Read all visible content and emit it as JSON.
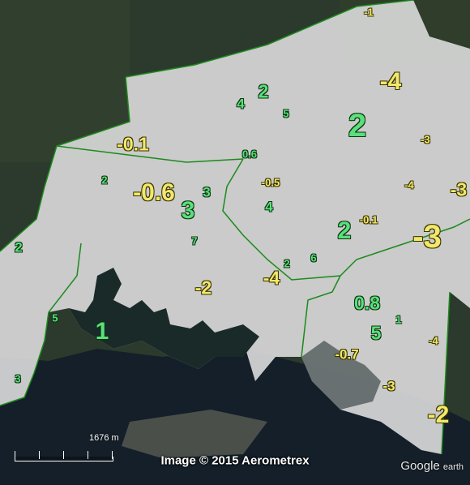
{
  "map": {
    "colors": {
      "land": "#2b3a2c",
      "water": "#141f29",
      "region": "#dcdcdc",
      "boundary": "#1c8a1c",
      "positive": "#59e07a",
      "negative": "#f2e86a"
    },
    "labels": [
      {
        "text": "-1",
        "kind": "neg"
      },
      {
        "text": "-4",
        "kind": "neg"
      },
      {
        "text": "2",
        "kind": "pos"
      },
      {
        "text": "4",
        "kind": "pos"
      },
      {
        "text": "5",
        "kind": "pos"
      },
      {
        "text": "2",
        "kind": "pos"
      },
      {
        "text": "-3",
        "kind": "neg"
      },
      {
        "text": "-0.1",
        "kind": "neg"
      },
      {
        "text": "0.6",
        "kind": "pos"
      },
      {
        "text": "2",
        "kind": "pos"
      },
      {
        "text": "-0.6",
        "kind": "neg"
      },
      {
        "text": "3",
        "kind": "pos"
      },
      {
        "text": "3",
        "kind": "pos"
      },
      {
        "text": "-0.5",
        "kind": "neg"
      },
      {
        "text": "4",
        "kind": "pos"
      },
      {
        "text": "-4",
        "kind": "neg"
      },
      {
        "text": "-3",
        "kind": "neg"
      },
      {
        "text": "-0.1",
        "kind": "neg"
      },
      {
        "text": "2",
        "kind": "pos"
      },
      {
        "text": "-3",
        "kind": "neg"
      },
      {
        "text": "2",
        "kind": "pos"
      },
      {
        "text": "7",
        "kind": "pos"
      },
      {
        "text": "2",
        "kind": "pos"
      },
      {
        "text": "6",
        "kind": "pos"
      },
      {
        "text": "-4",
        "kind": "neg"
      },
      {
        "text": "-2",
        "kind": "neg"
      },
      {
        "text": "0.8",
        "kind": "pos"
      },
      {
        "text": "1",
        "kind": "pos"
      },
      {
        "text": "5",
        "kind": "pos"
      },
      {
        "text": "5",
        "kind": "pos"
      },
      {
        "text": "1",
        "kind": "pos"
      },
      {
        "text": "-4",
        "kind": "neg"
      },
      {
        "text": "-0.7",
        "kind": "neg"
      },
      {
        "text": "3",
        "kind": "pos"
      },
      {
        "text": "-3",
        "kind": "neg"
      },
      {
        "text": "-2",
        "kind": "neg"
      }
    ],
    "scale_label": "1676 m",
    "attribution": "Image © 2015 Aerometrex",
    "logo_main": "Google",
    "logo_sub": "earth"
  }
}
